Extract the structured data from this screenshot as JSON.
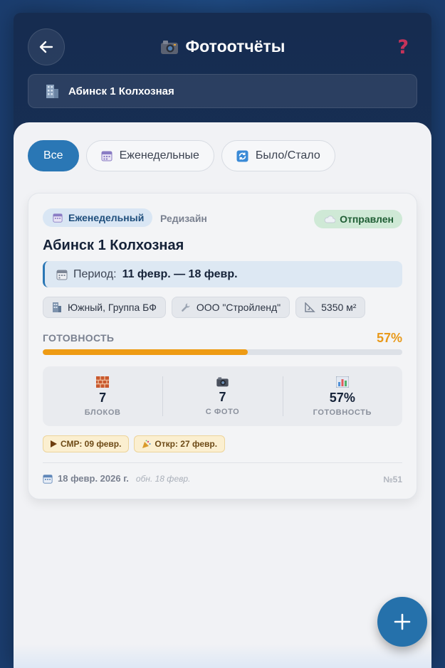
{
  "header": {
    "title": "Фотоотчёты",
    "title_icon": "camera-icon",
    "help_label": "?",
    "back_icon": "arrow-left-icon"
  },
  "object": {
    "name": "Абинск 1 Колхозная",
    "icon": "building-icon"
  },
  "filters": [
    {
      "label": "Все",
      "active": true
    },
    {
      "label": "Еженедельные",
      "icon": "calendar-icon"
    },
    {
      "label": "Было/Стало",
      "icon": "refresh-icon"
    }
  ],
  "report": {
    "type_label": "Еженедельный",
    "subtype": "Редизайн",
    "status": "Отправлен",
    "title": "Абинск 1 Колхозная",
    "period_label": "Период:",
    "period_value": "11 февр. — 18 февр.",
    "meta": [
      {
        "icon": "building-icon",
        "text": "Южный, Группа БФ"
      },
      {
        "icon": "wrench-icon",
        "text": "ООО \"Стройленд\""
      },
      {
        "icon": "ruler-icon",
        "text": "5350 м²"
      }
    ],
    "readiness_label": "ГОТОВНОСТЬ",
    "readiness_value": "57%",
    "readiness_fraction": 0.57,
    "stats": [
      {
        "icon": "bricks-icon",
        "value": "7",
        "label": "БЛОКОВ"
      },
      {
        "icon": "camera-icon",
        "value": "7",
        "label": "С ФОТО"
      },
      {
        "icon": "chart-icon",
        "value": "57%",
        "label": "ГОТОВНОСТЬ"
      }
    ],
    "dates": [
      {
        "icon": "play-icon",
        "text": "СМР: 09 февр."
      },
      {
        "icon": "party-icon",
        "text": "Откр: 27 февр."
      }
    ],
    "created": "18 февр. 2026 г.",
    "updated": "обн. 18 февр.",
    "number": "№51"
  },
  "colors": {
    "accent": "#2a77b5",
    "progress": "#ee9b14",
    "status_bg": "#cfe9d6",
    "header_bg": "#162c50"
  }
}
